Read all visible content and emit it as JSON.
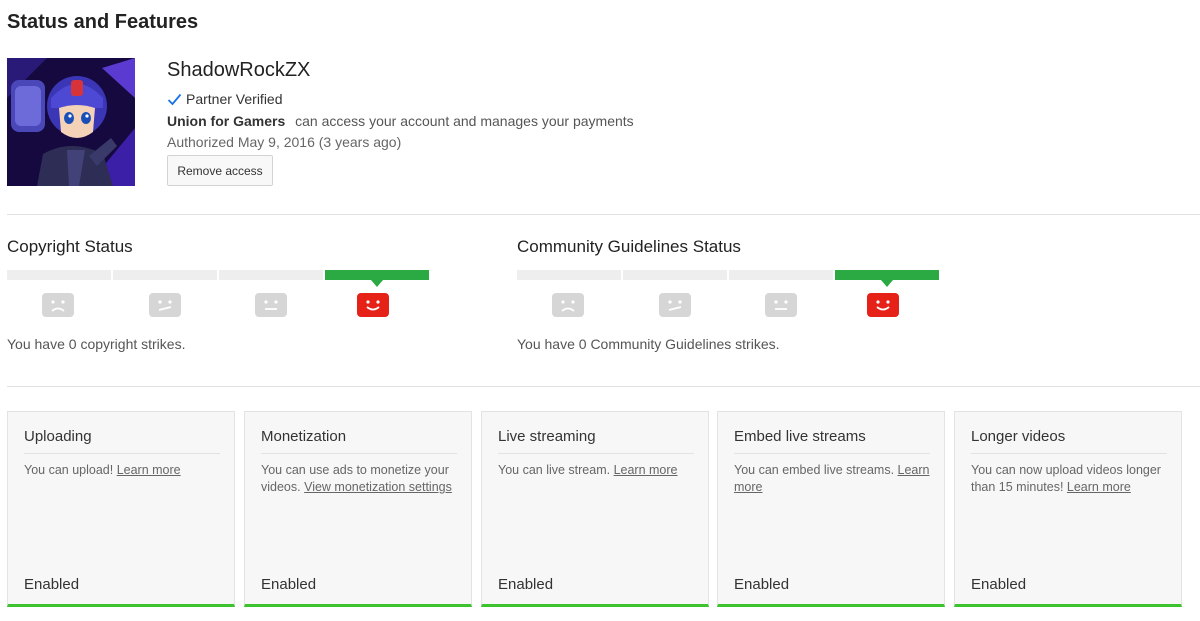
{
  "page": {
    "title": "Status and Features"
  },
  "account": {
    "channel_name": "ShadowRockZX",
    "partner_label": "Partner Verified",
    "org_name": "Union for Gamers",
    "access_text": "can access your account and manages your payments",
    "authorized_text": "Authorized May 9, 2016 (3 years ago)",
    "remove_button": "Remove access"
  },
  "copyright": {
    "title": "Copyright Status",
    "strike_text": "You have 0 copyright strikes.",
    "strike_level": 0
  },
  "community": {
    "title": "Community Guidelines Status",
    "strike_text": "You have 0 Community Guidelines strikes.",
    "strike_level": 0
  },
  "features": [
    {
      "title": "Uploading",
      "desc": "You can upload! ",
      "link": "Learn more",
      "status": "Enabled"
    },
    {
      "title": "Monetization",
      "desc": "You can use ads to monetize your videos. ",
      "link": "View monetization settings",
      "status": "Enabled"
    },
    {
      "title": "Live streaming",
      "desc": "You can live stream. ",
      "link": "Learn more",
      "status": "Enabled"
    },
    {
      "title": "Embed live streams",
      "desc": "You can embed live streams. ",
      "link": "Learn more",
      "status": "Enabled"
    },
    {
      "title": "Longer videos",
      "desc": "You can now upload videos longer than 15 minutes! ",
      "link": "Learn more",
      "status": "Enabled"
    }
  ],
  "colors": {
    "active_segment": "#2baa44",
    "active_face": "#e62117",
    "inactive_face": "#d6d6d6",
    "enabled_bar": "#3ec330",
    "check": "#1a73e8"
  },
  "icons": {
    "face_sad": "sad-face-icon",
    "face_unsure": "unsure-face-icon",
    "face_neutral": "neutral-face-icon",
    "face_happy": "happy-face-icon",
    "check": "check-icon"
  }
}
